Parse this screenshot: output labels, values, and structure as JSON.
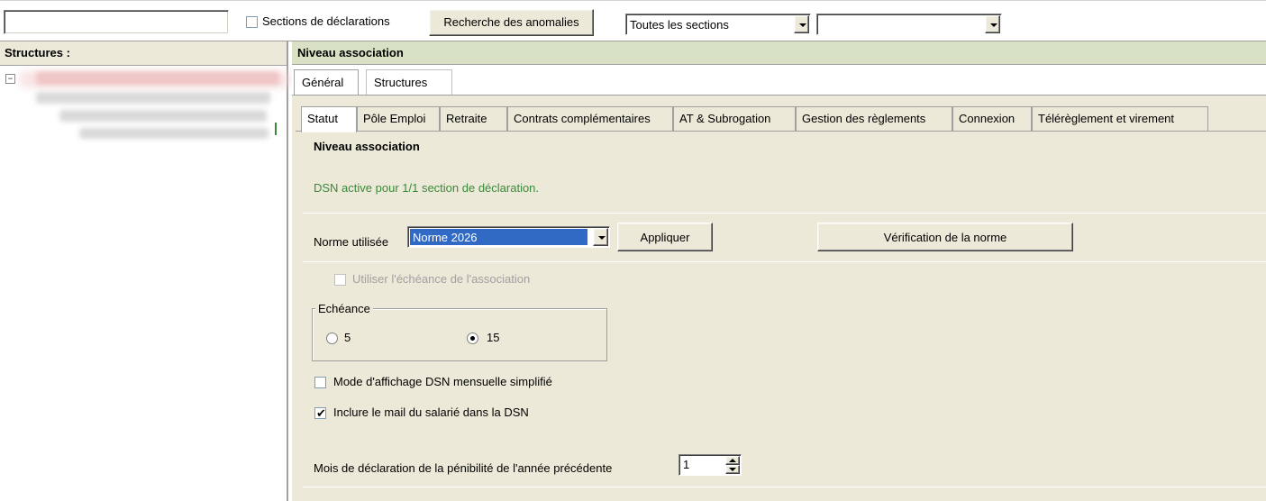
{
  "toolbar": {
    "search_value": "",
    "sections_checkbox_label": "Sections de déclarations",
    "sections_checked": false,
    "anomalies_button": "Recherche des anomalies",
    "sections_filter_selected": "Toutes les sections",
    "second_filter_selected": ""
  },
  "left_pane": {
    "header": "Structures :"
  },
  "right_pane": {
    "header": "Niveau association",
    "outer_tabs": [
      {
        "label": "Général",
        "active": true
      },
      {
        "label": "Structures",
        "active": false
      }
    ],
    "inner_tabs": [
      {
        "label": "Statut",
        "active": true
      },
      {
        "label": "Pôle Emploi",
        "active": false
      },
      {
        "label": "Retraite",
        "active": false
      },
      {
        "label": "Contrats complémentaires",
        "active": false
      },
      {
        "label": "AT & Subrogation",
        "active": false
      },
      {
        "label": "Gestion des règlements",
        "active": false
      },
      {
        "label": "Connexion",
        "active": false
      },
      {
        "label": "Télérèglement et virement",
        "active": false
      }
    ]
  },
  "statut": {
    "section_title": "Niveau association",
    "dsn_status": "DSN active pour 1/1 section de déclaration.",
    "dsn_status_color": "#3a8a3a",
    "norme_label": "Norme utilisée",
    "norme_selected": "Norme 2026",
    "apply_button": "Appliquer",
    "verify_button": "Vérification de la norme",
    "use_association_deadline_label": "Utiliser l'échéance de l'association",
    "use_association_deadline_checked": false,
    "use_association_deadline_enabled": false,
    "echeance_group_title": "Echéance",
    "echeance_options": [
      {
        "label": "5",
        "selected": false
      },
      {
        "label": "15",
        "selected": true
      }
    ],
    "simplified_mode_label": "Mode d'affichage DSN mensuelle simplifié",
    "simplified_mode_checked": false,
    "include_email_label": "Inclure le mail du salarié dans la DSN",
    "include_email_checked": true,
    "penibilite_label": "Mois de déclaration de la pénibilité de l'année précédente",
    "penibilite_value": "1"
  },
  "colors": {
    "panel_bg": "#ece9d8",
    "header_green": "#d9e1c4",
    "selection_blue": "#316ac5"
  }
}
